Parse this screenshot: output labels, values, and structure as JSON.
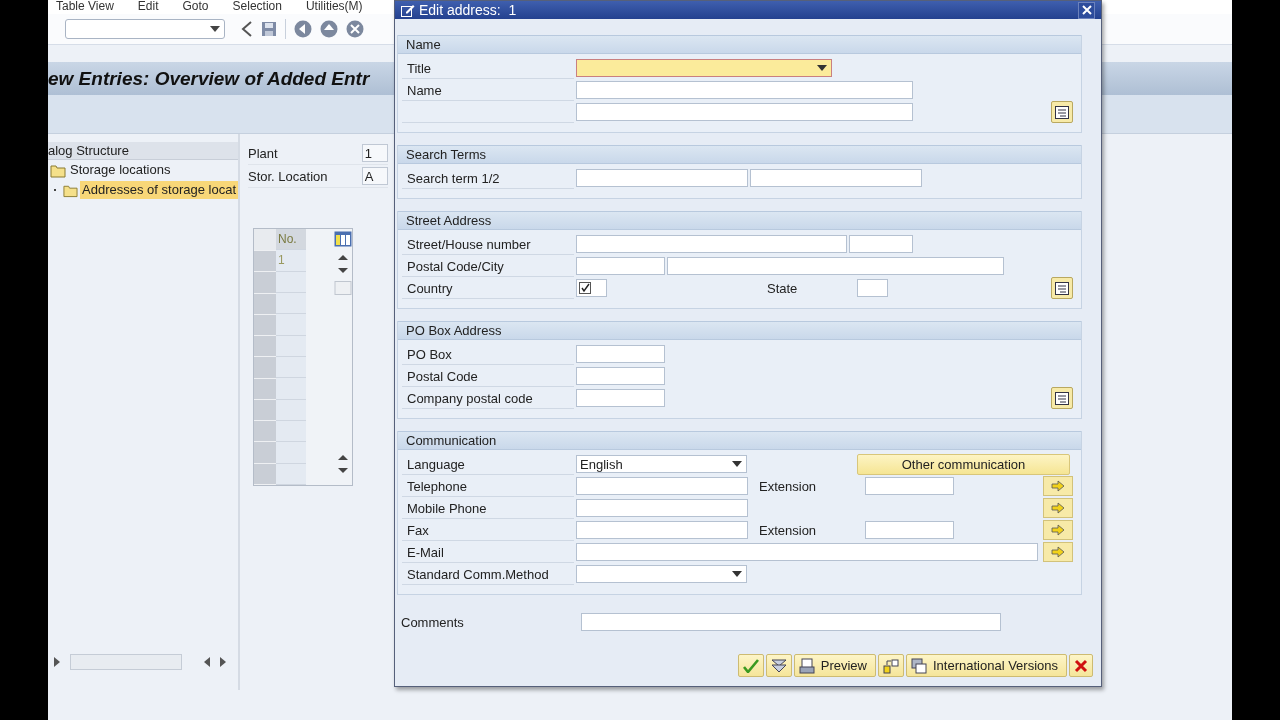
{
  "menu": [
    "Table View",
    "Edit",
    "Goto",
    "Selection",
    "Utilities(M)"
  ],
  "screen_title": "ew Entries: Overview of Added Entr",
  "dialog_structure": {
    "title": "alog Structure",
    "items": [
      {
        "label": "Storage locations",
        "selected": false,
        "children": [
          {
            "label": "Addresses of storage locat",
            "selected": true
          }
        ]
      }
    ]
  },
  "header_fields": [
    {
      "label": "Plant",
      "value": "1"
    },
    {
      "label": "Stor. Location",
      "value": "A"
    }
  ],
  "table": {
    "columns": [
      "No."
    ],
    "rows": [
      [
        "1"
      ]
    ]
  },
  "dialog": {
    "title": "Edit address:  1",
    "groups": [
      {
        "title": "Name",
        "rows": [
          {
            "label": "Title",
            "fields": [
              {
                "kind": "dropdown",
                "focused": true
              }
            ]
          },
          {
            "label": "Name",
            "fields": [
              {
                "kind": "input"
              }
            ]
          },
          {
            "fields": [
              {
                "kind": "input"
              },
              {
                "kind": "expand"
              }
            ]
          }
        ]
      },
      {
        "title": "Search Terms",
        "rows": [
          {
            "label": "Search term 1/2",
            "fields": [
              {
                "kind": "input"
              },
              {
                "kind": "input"
              }
            ]
          }
        ]
      },
      {
        "title": "Street Address",
        "rows": [
          {
            "label": "Street/House number",
            "fields": [
              {
                "kind": "input"
              },
              {
                "kind": "input"
              }
            ]
          },
          {
            "label": "Postal Code/City",
            "fields": [
              {
                "kind": "input"
              },
              {
                "kind": "input"
              }
            ]
          },
          {
            "label": "Country",
            "fields": [
              {
                "kind": "checkfield",
                "checked": true
              },
              {
                "kind": "label",
                "text": "State"
              },
              {
                "kind": "input"
              },
              {
                "kind": "expand"
              }
            ]
          }
        ]
      },
      {
        "title": "PO Box Address",
        "rows": [
          {
            "label": "PO Box",
            "fields": [
              {
                "kind": "input"
              }
            ]
          },
          {
            "label": "Postal Code",
            "fields": [
              {
                "kind": "input"
              }
            ]
          },
          {
            "label": "Company postal code",
            "fields": [
              {
                "kind": "input"
              },
              {
                "kind": "expand"
              }
            ]
          }
        ]
      },
      {
        "title": "Communication",
        "rows": [
          {
            "label": "Language",
            "fields": [
              {
                "kind": "dropdown",
                "value": "English",
                "focused": false
              },
              {
                "kind": "button",
                "text": "Other communication"
              }
            ]
          },
          {
            "label": "Telephone",
            "fields": [
              {
                "kind": "input"
              },
              {
                "kind": "label",
                "text": "Extension"
              },
              {
                "kind": "input"
              },
              {
                "kind": "arrow"
              }
            ]
          },
          {
            "label": "Mobile Phone",
            "fields": [
              {
                "kind": "input"
              },
              {
                "kind": "arrow"
              }
            ]
          },
          {
            "label": "Fax",
            "fields": [
              {
                "kind": "input"
              },
              {
                "kind": "label",
                "text": "Extension"
              },
              {
                "kind": "input"
              },
              {
                "kind": "arrow"
              }
            ]
          },
          {
            "label": "E-Mail",
            "fields": [
              {
                "kind": "input"
              },
              {
                "kind": "arrow"
              }
            ]
          },
          {
            "label": "Standard Comm.Method",
            "fields": [
              {
                "kind": "dropdown",
                "focused": false
              }
            ]
          }
        ]
      }
    ],
    "comments_label": "Comments",
    "buttons": [
      {
        "kind": "confirm"
      },
      {
        "kind": "check"
      },
      {
        "kind": "preview",
        "label": "Preview"
      },
      {
        "kind": "copy"
      },
      {
        "kind": "versions",
        "label": "International Versions"
      },
      {
        "kind": "cancel"
      }
    ]
  }
}
